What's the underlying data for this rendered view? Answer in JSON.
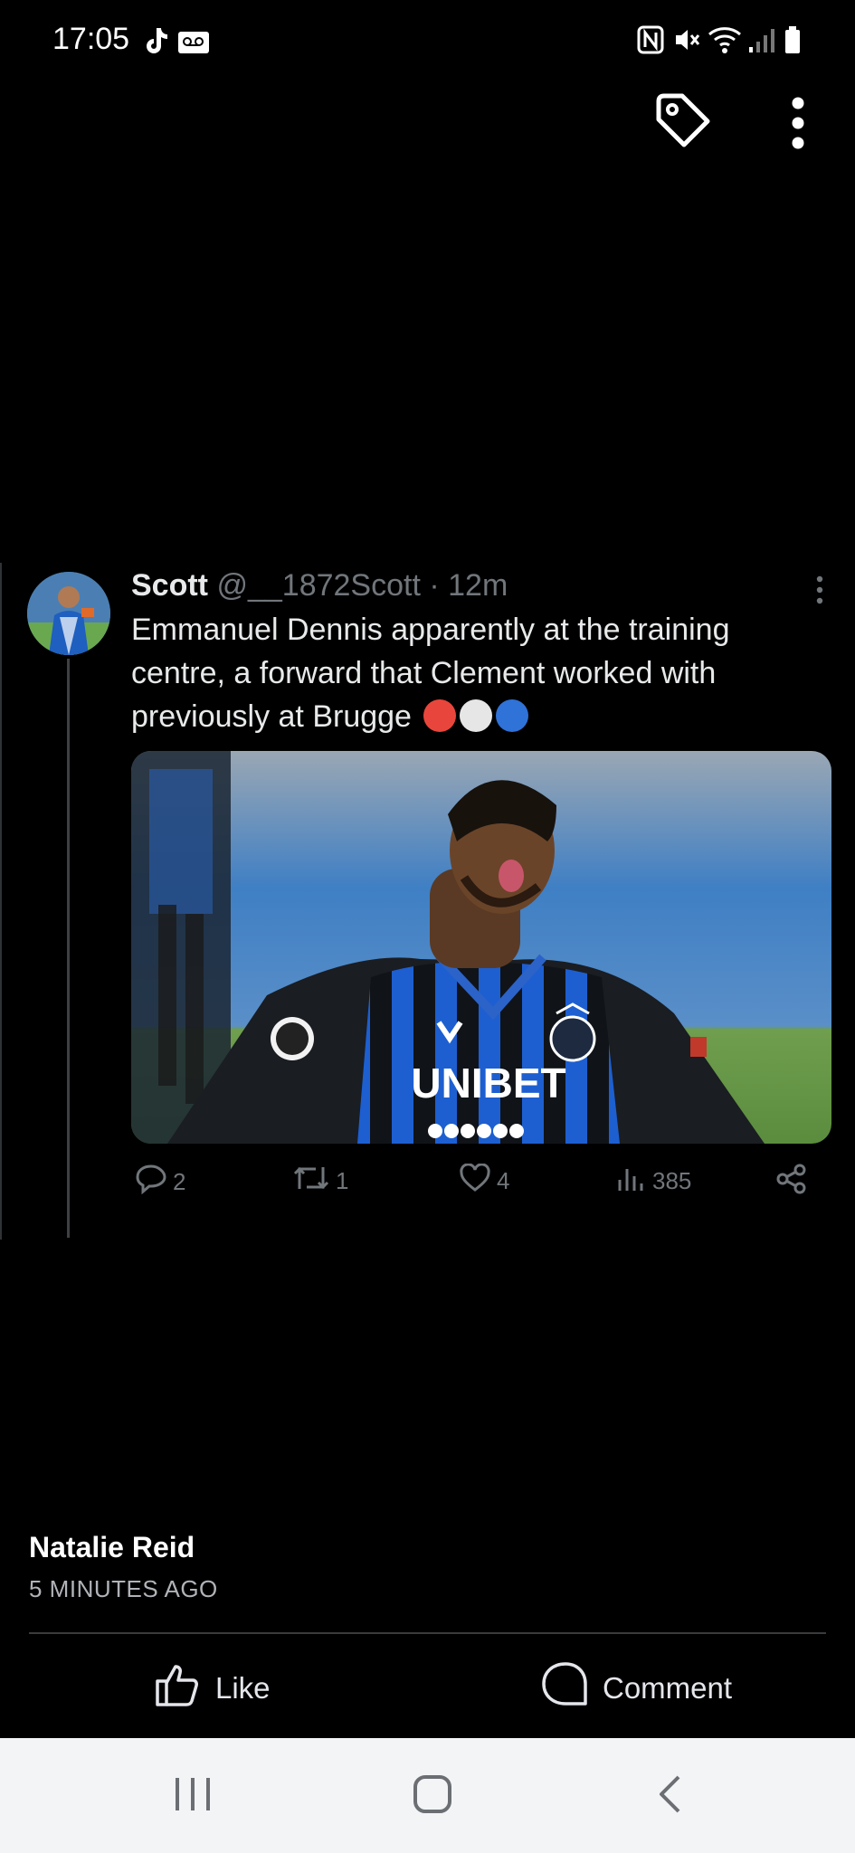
{
  "status_bar": {
    "time": "17:05",
    "left_icons": [
      "tiktok-icon",
      "voicemail-icon"
    ],
    "right_icons": [
      "nfc-icon",
      "mute-icon",
      "wifi-icon",
      "signal-icon",
      "battery-icon"
    ]
  },
  "top_actions": {
    "icons": [
      "tag-icon",
      "more-vertical-icon"
    ]
  },
  "tweet": {
    "name": "Scott",
    "handle": "@__1872Scott",
    "separator": "·",
    "age": "12m",
    "text": "Emmanuel Dennis apparently at the training centre, a forward that Clement worked with previously at Brugge",
    "emoji_colors": [
      "#e8463c",
      "#e6e6e6",
      "#2f72d8"
    ],
    "image_text": {
      "sponsor": "UNIBET"
    },
    "actions": {
      "replies": "2",
      "retweets": "1",
      "likes": "4",
      "views": "385"
    }
  },
  "post": {
    "author": "Natalie Reid",
    "time_ago": "5 MINUTES AGO",
    "like_label": "Like",
    "comment_label": "Comment"
  },
  "colors": {
    "background": "#000000",
    "muted": "#71767b",
    "nav_bar": "#f3f4f6"
  }
}
